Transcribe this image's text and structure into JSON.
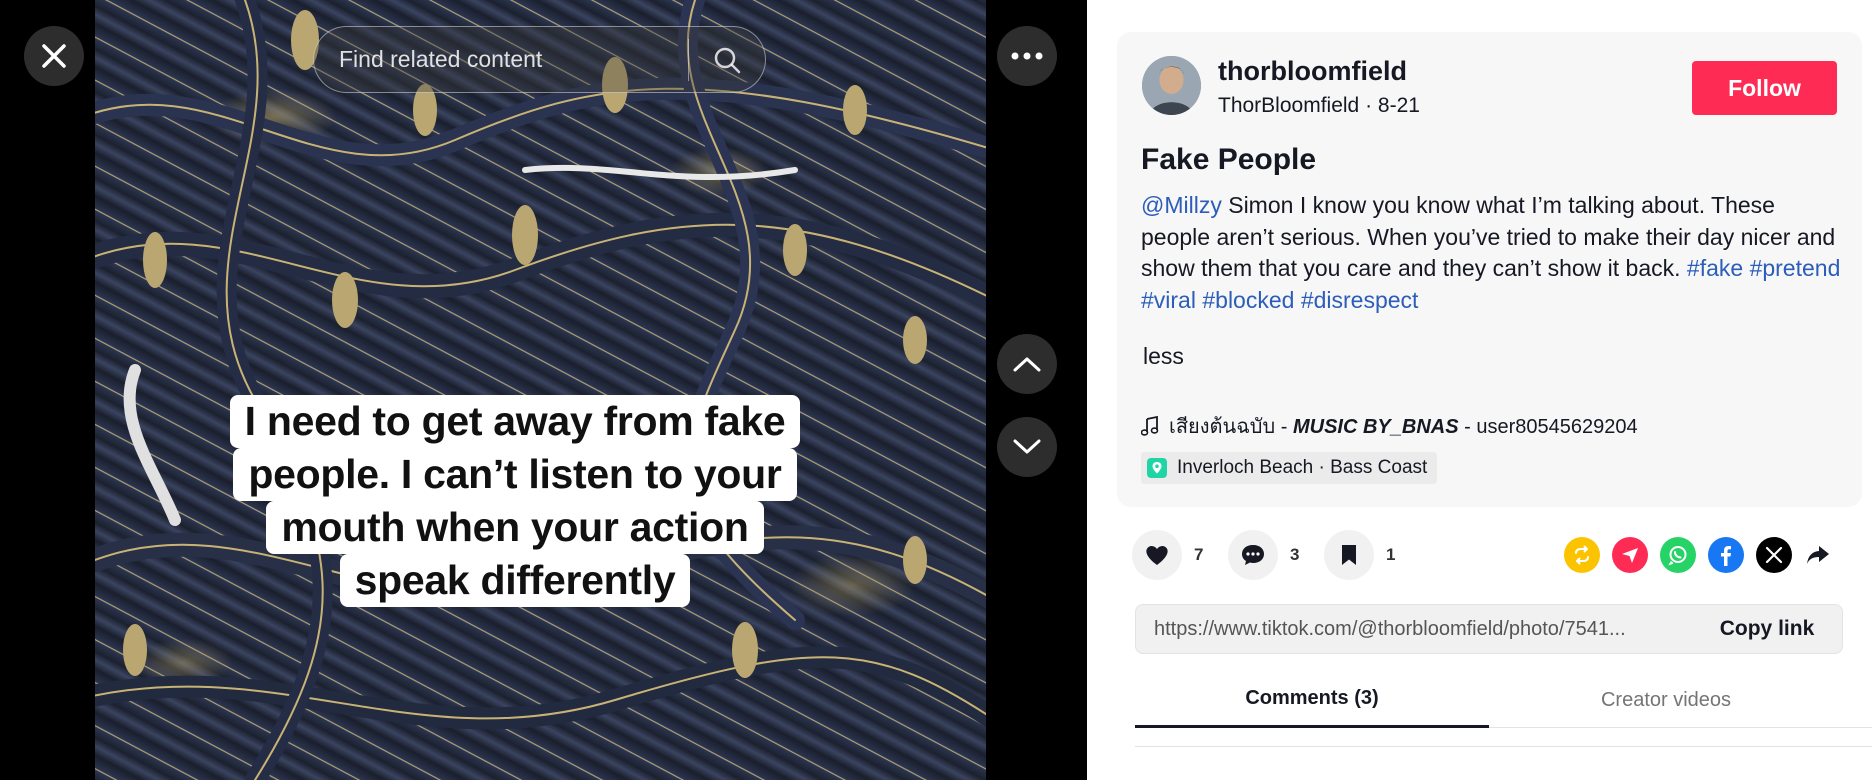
{
  "viewer": {
    "search_placeholder": "Find related content",
    "caption_lines": [
      "I need to get away from fake",
      "people. I can’t listen to your",
      "mouth when your action",
      "speak differently"
    ]
  },
  "author": {
    "username": "thorbloomfield",
    "display_name": "ThorBloomfield",
    "date": "8-21",
    "follow_label": "Follow"
  },
  "post": {
    "title": "Fake People",
    "mention": "@Millzy",
    "body": " Simon I know you know what I’m talking about. These people aren’t serious. When you’ve tried to make their day nicer and show them that you care and they can’t show it back. ",
    "hashtags": [
      "#fake",
      "#pretend",
      "#viral",
      "#blocked",
      "#disrespect"
    ],
    "less_label": "less",
    "music": {
      "title": "เสียงต้นฉบับ",
      "sep1": " - ",
      "artist": "MUSIC BY_BNAS",
      "sep2": " - ",
      "user": "user80545629204"
    },
    "location": "Inverloch Beach · Bass Coast"
  },
  "actions": {
    "likes": "7",
    "comments": "3",
    "saves": "1"
  },
  "share_colors": {
    "repost": "#fcc400",
    "send": "#fe2c55",
    "whatsapp": "#25d366",
    "facebook": "#1877f2",
    "x": "#000000"
  },
  "link": {
    "url": "https://www.tiktok.com/@thorbloomfield/photo/7541...",
    "copy_label": "Copy link"
  },
  "tabs": {
    "comments": "Comments (3)",
    "creator_videos": "Creator videos"
  }
}
